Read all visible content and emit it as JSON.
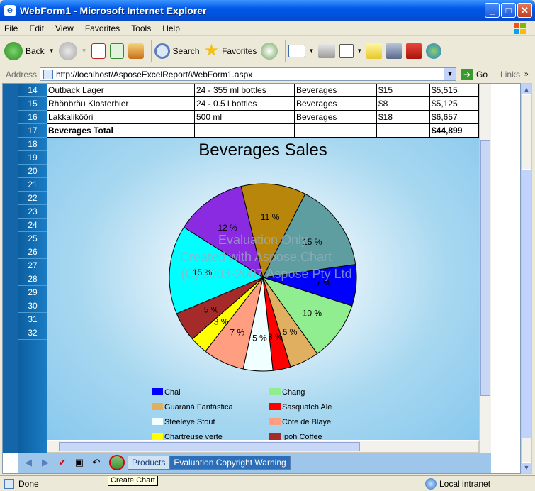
{
  "window": {
    "title": "WebForm1 - Microsoft Internet Explorer",
    "min": "_",
    "max": "□",
    "close": "✕"
  },
  "menu": [
    "File",
    "Edit",
    "View",
    "Favorites",
    "Tools",
    "Help"
  ],
  "toolbar": {
    "back": "Back",
    "search": "Search",
    "favorites": "Favorites"
  },
  "address": {
    "label": "Address",
    "url": "http://localhost/AsposeExcelReport/WebForm1.aspx",
    "go": "Go",
    "links": "Links"
  },
  "rows": [
    "14",
    "15",
    "16",
    "17",
    "18",
    "19",
    "20",
    "21",
    "22",
    "23",
    "24",
    "25",
    "26",
    "27",
    "28",
    "29",
    "30",
    "31",
    "32"
  ],
  "table": [
    [
      "Outback Lager",
      "24 - 355 ml bottles",
      "Beverages",
      "$15",
      "$5,515"
    ],
    [
      "Rhönbräu Klosterbier",
      "24 - 0.5 l bottles",
      "Beverages",
      "$8",
      "$5,125"
    ],
    [
      "Lakkalikööri",
      "500 ml",
      "Beverages",
      "$18",
      "$6,657"
    ],
    [
      "Beverages Total",
      "",
      "",
      "",
      "$44,899"
    ]
  ],
  "chart_data": {
    "type": "pie",
    "title": "Beverages Sales",
    "slices": [
      {
        "label": "Chai",
        "value": 7,
        "color": "#0000ff"
      },
      {
        "label": "Chang",
        "value": 10,
        "color": "#90ee90"
      },
      {
        "label": "Guaraná Fantástica",
        "value": 5,
        "color": "#e0b060"
      },
      {
        "label": "Sasquatch Ale",
        "value": 3,
        "color": "#ff0000"
      },
      {
        "label": "Steeleye Stout",
        "value": 5,
        "color": "#f0ffff"
      },
      {
        "label": "Côte de Blaye",
        "value": 7,
        "color": "#ff9e80"
      },
      {
        "label": "Chartreuse verte",
        "value": 3,
        "color": "#ffff00"
      },
      {
        "label": "Ipoh Coffee",
        "value": 5,
        "color": "#a52a2a"
      },
      {
        "label": "",
        "value": 15,
        "color": "#00ffff"
      },
      {
        "label": "",
        "value": 12,
        "color": "#8a2be2"
      },
      {
        "label": "",
        "value": 11,
        "color": "#b8860b"
      },
      {
        "label": "",
        "value": 15,
        "color": "#5f9ea0"
      }
    ],
    "legend": [
      "Chai",
      "Chang",
      "Guaraná Fantástica",
      "Sasquatch Ale",
      "Steeleye Stout",
      "Côte de Blaye",
      "Chartreuse verte",
      "Ipoh Coffee"
    ],
    "watermark": [
      "Evaluation Only",
      "Created with Aspose.Chart",
      "(C) 2003-2007 Aspose Pty Ltd"
    ]
  },
  "worksheet": {
    "tabs": [
      "Products",
      "Evaluation Copyright Warning"
    ],
    "tooltip": "Create Chart"
  },
  "status": {
    "text": "Done",
    "zone": "Local intranet"
  }
}
